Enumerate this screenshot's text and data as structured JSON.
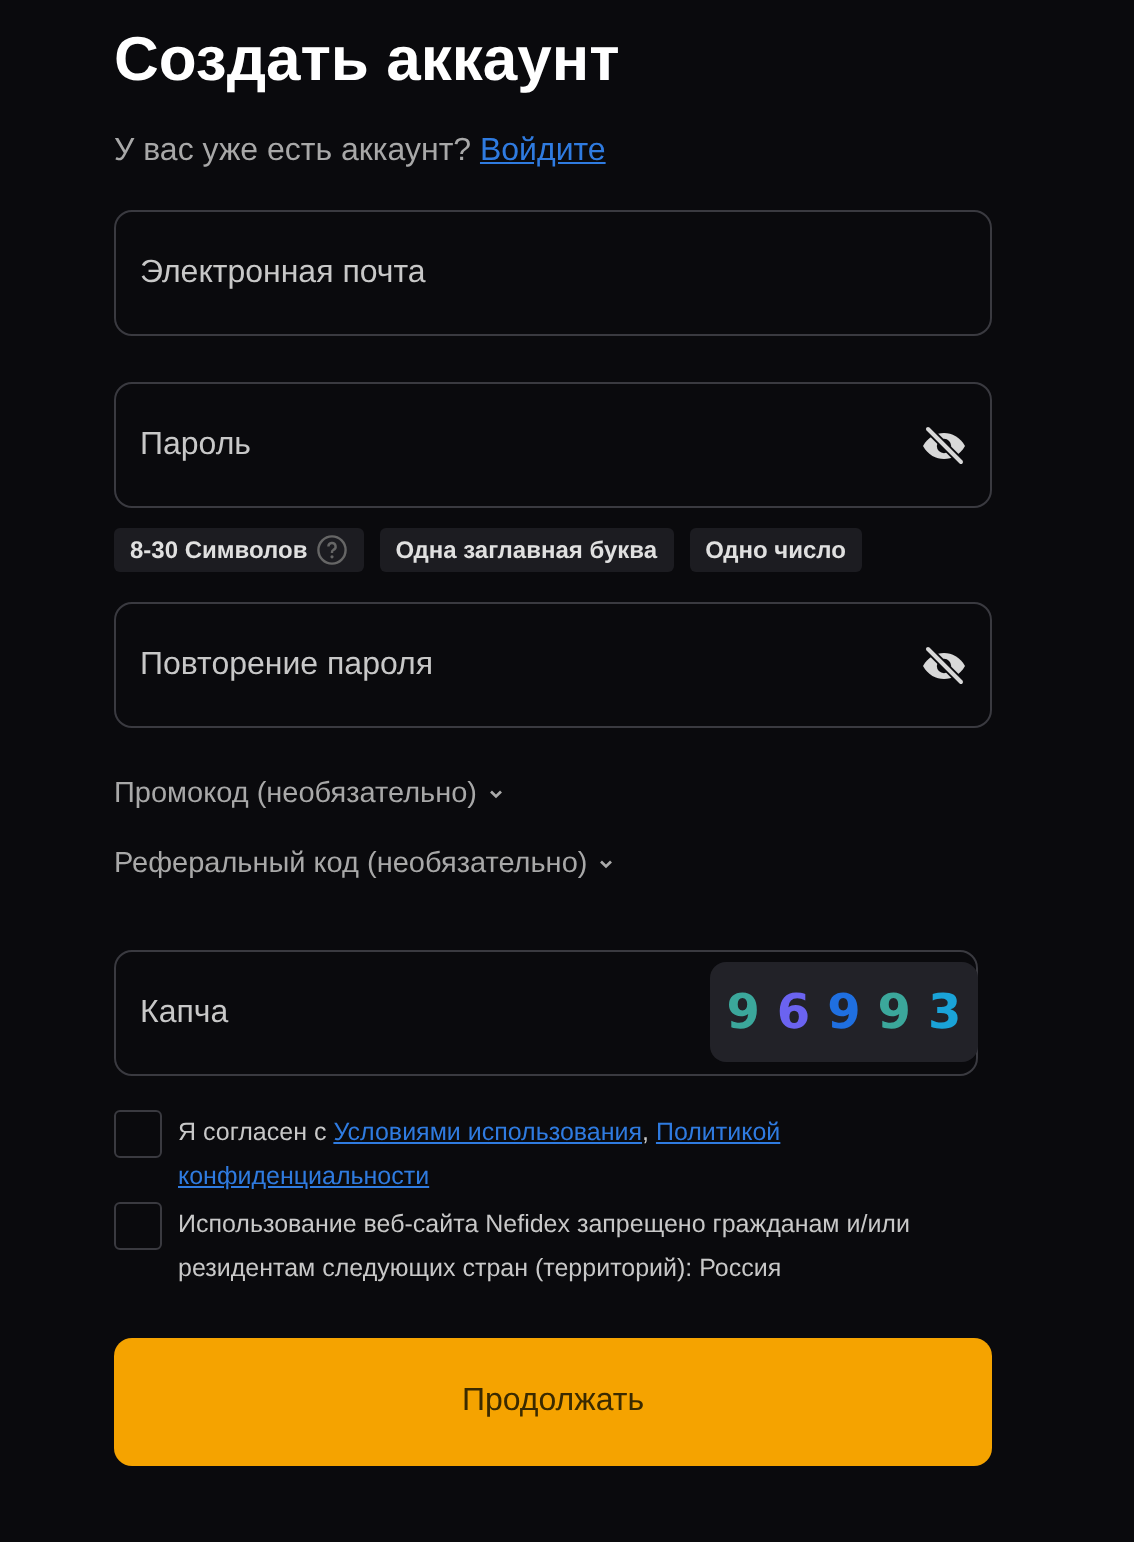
{
  "title": "Создать аккаунт",
  "login_prompt": {
    "text": "У вас уже есть аккаунт?",
    "link": "Войдите"
  },
  "fields": [
    {
      "kind": "text",
      "placeholder": "Электронная почта"
    },
    {
      "kind": "password",
      "placeholder": "Пароль",
      "hints": [
        {
          "text": "8-30 Символов",
          "help": true
        },
        {
          "text": "Одна заглавная буква",
          "help": false
        },
        {
          "text": "Одно число",
          "help": false
        }
      ]
    },
    {
      "kind": "password",
      "placeholder": "Повторение пароля"
    }
  ],
  "optional": [
    {
      "label": "Промокод (необязательно)",
      "expanded": false
    },
    {
      "label": "Реферальный код (необязательно)",
      "expanded": false
    }
  ],
  "captcha": {
    "placeholder": "Капча",
    "digits": [
      {
        "text": "9",
        "color": "#3ba79b"
      },
      {
        "text": "6",
        "color": "#6b63f0"
      },
      {
        "text": "9",
        "color": "#1f6fe0"
      },
      {
        "text": "9",
        "color": "#3ba79b"
      },
      {
        "text": "3",
        "color": "#1aa3d8"
      }
    ]
  },
  "agreements": [
    {
      "checked": false,
      "parts": [
        {
          "kind": "text",
          "text": "Я согласен с "
        },
        {
          "kind": "link",
          "text": "Условиями использования"
        },
        {
          "kind": "text",
          "text": ", "
        },
        {
          "kind": "wrapping_link",
          "text": "Политикой конфиденциальности"
        }
      ]
    },
    {
      "checked": false,
      "parts": [
        {
          "kind": "text",
          "text": "Использование веб-сайта Nefidex запрещено гражданам и/или резидентам следующих стран (территорий): Россия"
        }
      ]
    }
  ],
  "submit": "Продолжать"
}
